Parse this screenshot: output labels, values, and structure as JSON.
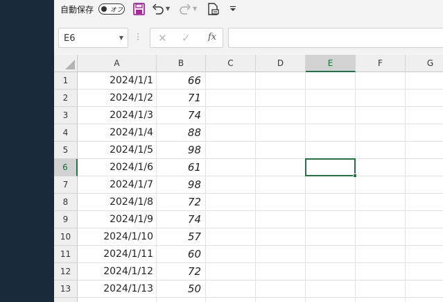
{
  "toolbar": {
    "autosave_label": "自動保存",
    "autosave_state": "オフ",
    "icons": [
      "save-icon",
      "undo-icon",
      "redo-icon",
      "print-preview-icon",
      "customize-qat-icon"
    ]
  },
  "formula_bar": {
    "name_box": "E6",
    "fx_label": "fx",
    "formula": ""
  },
  "sheet": {
    "columns": [
      "A",
      "B",
      "C",
      "D",
      "E",
      "F",
      "G"
    ],
    "selected_cell": "E6",
    "rows": [
      {
        "row": "1",
        "a": "2024/1/1",
        "b": "66"
      },
      {
        "row": "2",
        "a": "2024/1/2",
        "b": "71"
      },
      {
        "row": "3",
        "a": "2024/1/3",
        "b": "74"
      },
      {
        "row": "4",
        "a": "2024/1/4",
        "b": "88"
      },
      {
        "row": "5",
        "a": "2024/1/5",
        "b": "98"
      },
      {
        "row": "6",
        "a": "2024/1/6",
        "b": "61"
      },
      {
        "row": "7",
        "a": "2024/1/7",
        "b": "98"
      },
      {
        "row": "8",
        "a": "2024/1/8",
        "b": "72"
      },
      {
        "row": "9",
        "a": "2024/1/9",
        "b": "74"
      },
      {
        "row": "10",
        "a": "2024/1/10",
        "b": "57"
      },
      {
        "row": "11",
        "a": "2024/1/11",
        "b": "60"
      },
      {
        "row": "12",
        "a": "2024/1/12",
        "b": "72"
      },
      {
        "row": "13",
        "a": "2024/1/13",
        "b": "50"
      }
    ]
  },
  "colors": {
    "accent": "#217346",
    "save_icon": "#a42a9c",
    "side_panel": "#1b2a3a"
  }
}
